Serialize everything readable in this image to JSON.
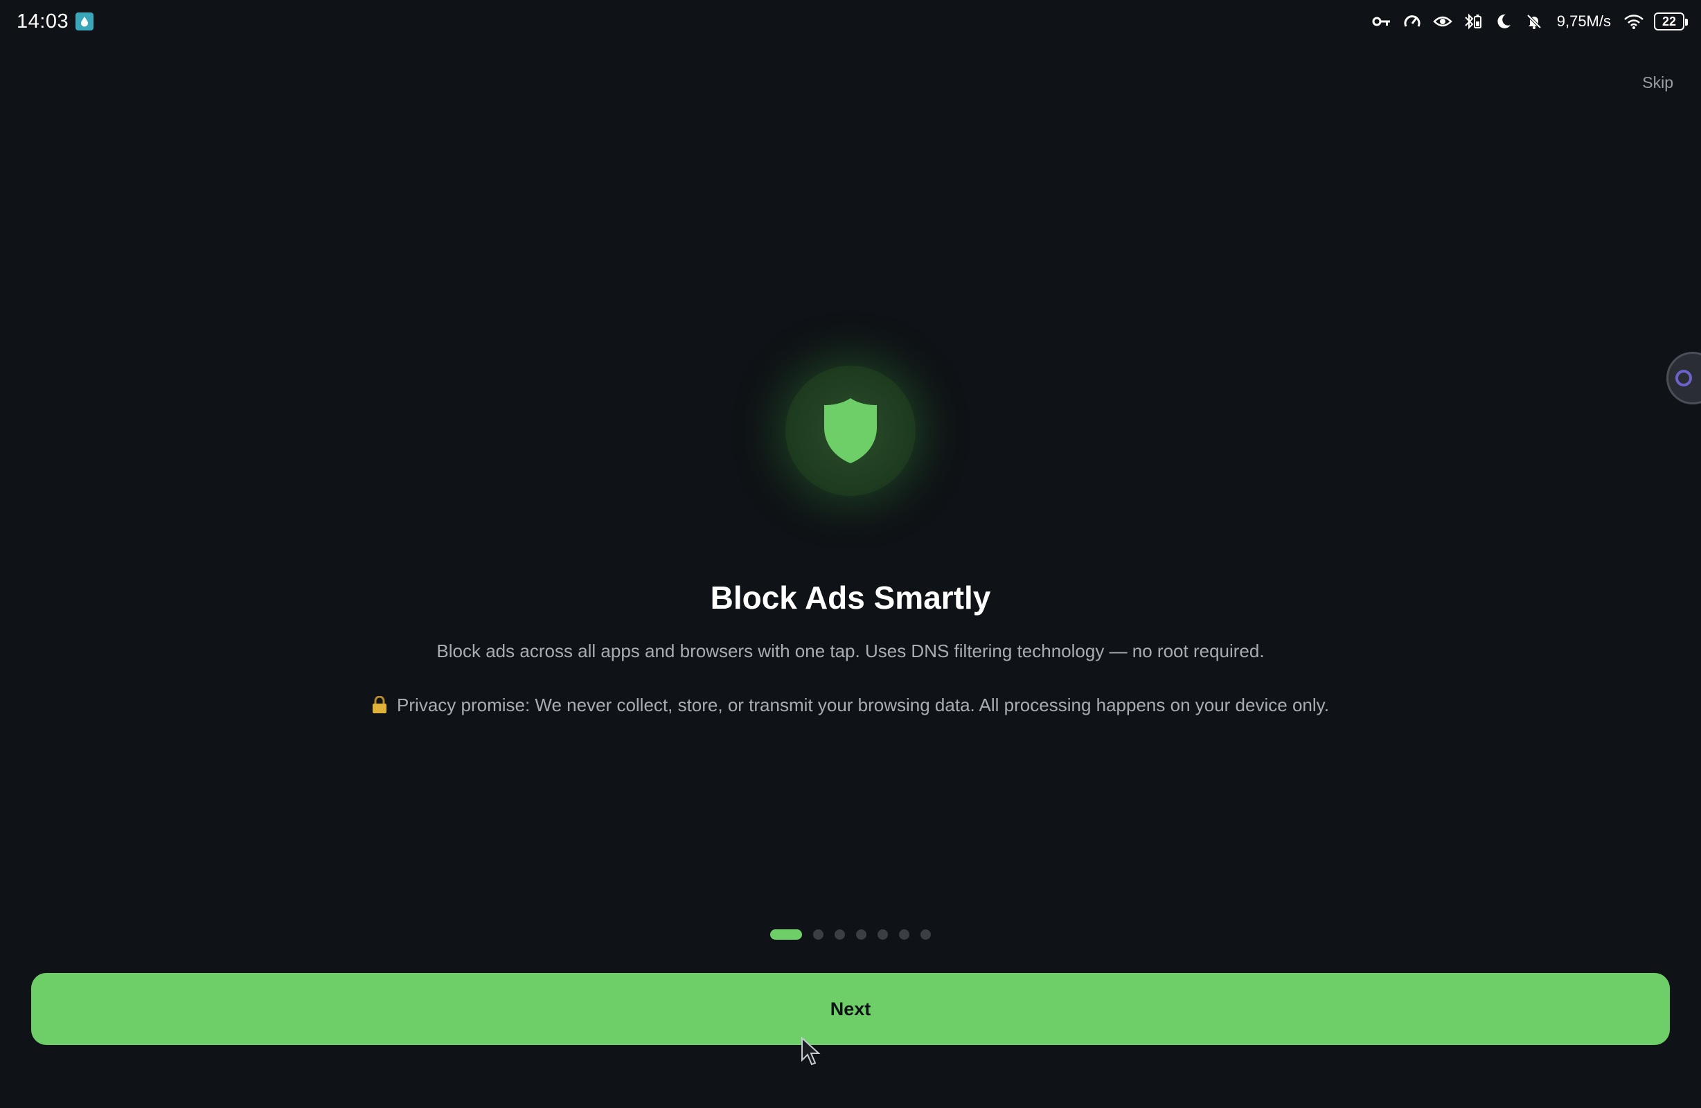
{
  "status_bar": {
    "time": "14:03",
    "net_speed": "9,75M/s",
    "battery": "22",
    "icons": [
      "vpn-key-icon",
      "speed-icon",
      "eye-icon",
      "bluetooth-battery-icon",
      "moon-icon",
      "bell-off-icon",
      "wifi-icon",
      "battery-icon"
    ]
  },
  "header": {
    "skip_label": "Skip"
  },
  "onboarding": {
    "icon": "shield-icon",
    "title": "Block Ads Smartly",
    "description": "Block ads across all apps and browsers with one tap. Uses DNS filtering technology — no root required.",
    "privacy_note": "Privacy promise: We never collect, store, or transmit your browsing data. All processing happens on your device only.",
    "privacy_icon": "lock-icon",
    "total_pages": 7,
    "current_page": 1
  },
  "actions": {
    "next_label": "Next"
  },
  "colors": {
    "background": "#0f1216",
    "accent": "#6ecf68",
    "muted_text": "#a9adb3",
    "inactive_dot": "#3a3e45"
  }
}
